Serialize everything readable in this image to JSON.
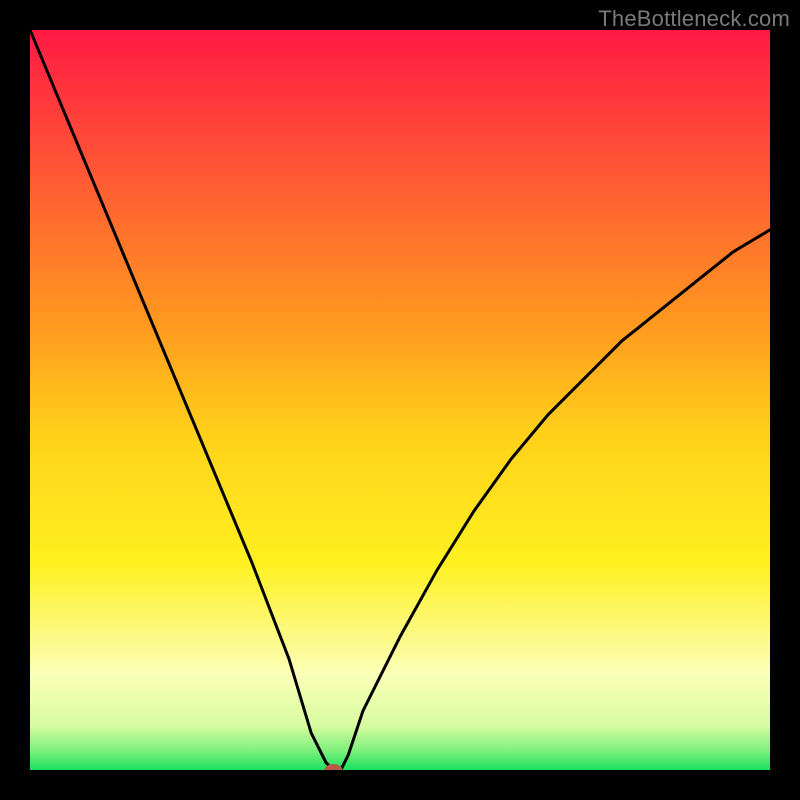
{
  "watermark": "TheBottleneck.com",
  "chart_data": {
    "type": "line",
    "title": "",
    "xlabel": "",
    "ylabel": "",
    "xlim": [
      0,
      100
    ],
    "ylim": [
      0,
      100
    ],
    "grid": false,
    "legend": false,
    "series": [
      {
        "name": "bottleneck-curve",
        "x": [
          0,
          5,
          10,
          15,
          20,
          25,
          30,
          35,
          38,
          40,
          41,
          42,
          43,
          45,
          50,
          55,
          60,
          65,
          70,
          75,
          80,
          85,
          90,
          95,
          100
        ],
        "y": [
          100,
          88,
          76,
          64,
          52,
          40,
          28,
          15,
          5,
          1,
          0,
          0,
          2,
          8,
          18,
          27,
          35,
          42,
          48,
          53,
          58,
          62,
          66,
          70,
          73
        ]
      }
    ],
    "marker": {
      "name": "optimal-point",
      "x": 41,
      "y": 0
    },
    "gradient_stops": [
      {
        "offset": 0.0,
        "color": "#ff1a44"
      },
      {
        "offset": 0.2,
        "color": "#ff5a34"
      },
      {
        "offset": 0.4,
        "color": "#ff9a1f"
      },
      {
        "offset": 0.55,
        "color": "#ffd21a"
      },
      {
        "offset": 0.72,
        "color": "#fff020"
      },
      {
        "offset": 0.87,
        "color": "#fbffb8"
      },
      {
        "offset": 0.94,
        "color": "#d8fca0"
      },
      {
        "offset": 0.975,
        "color": "#7af07a"
      },
      {
        "offset": 1.0,
        "color": "#18e060"
      }
    ]
  }
}
